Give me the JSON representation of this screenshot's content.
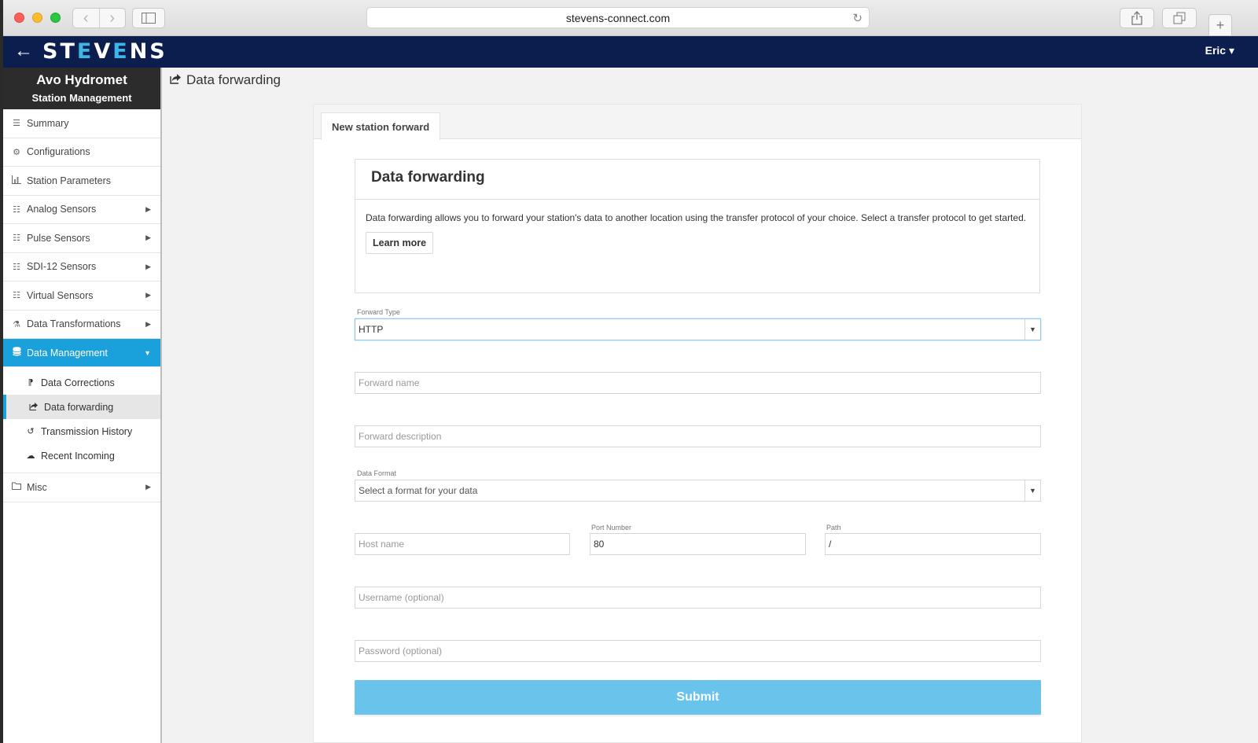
{
  "browser": {
    "url": "stevens-connect.com"
  },
  "topbar": {
    "logo": "STEVENS",
    "user": "Eric"
  },
  "sidebar": {
    "station_name": "Avo Hydromet",
    "station_sub": "Station Management",
    "items": [
      {
        "label": "Summary",
        "icon": "list-icon"
      },
      {
        "label": "Configurations",
        "icon": "gear-icon"
      },
      {
        "label": "Station Parameters",
        "icon": "chart-icon"
      },
      {
        "label": "Analog Sensors",
        "icon": "sliders-icon"
      },
      {
        "label": "Pulse Sensors",
        "icon": "sliders-icon"
      },
      {
        "label": "SDI-12 Sensors",
        "icon": "sliders-icon"
      },
      {
        "label": "Virtual Sensors",
        "icon": "sliders-icon"
      },
      {
        "label": "Data Transformations",
        "icon": "flask-icon"
      },
      {
        "label": "Data Management",
        "icon": "database-icon"
      }
    ],
    "sub_items": [
      {
        "label": "Data Corrections",
        "icon": "correction-icon"
      },
      {
        "label": "Data forwarding",
        "icon": "share-icon"
      },
      {
        "label": "Transmission History",
        "icon": "history-icon"
      },
      {
        "label": "Recent Incoming",
        "icon": "cloud-icon"
      }
    ],
    "misc": {
      "label": "Misc",
      "icon": "folder-icon"
    }
  },
  "page": {
    "title": "Data forwarding"
  },
  "card": {
    "tab": "New station forward",
    "info_title": "Data forwarding",
    "info_text": "Data forwarding allows you to forward your station's data to another location using the transfer protocol of your choice. Select a transfer protocol to get started.",
    "learn_more": "Learn more"
  },
  "form": {
    "forward_type_label": "Forward Type",
    "forward_type_value": "HTTP",
    "forward_name_placeholder": "Forward name",
    "forward_description_placeholder": "Forward description",
    "data_format_label": "Data Format",
    "data_format_placeholder": "Select a format for your data",
    "host_name_placeholder": "Host name",
    "port_label": "Port Number",
    "port_value": "80",
    "path_label": "Path",
    "path_value": "/",
    "username_placeholder": "Username (optional)",
    "password_placeholder": "Password (optional)",
    "submit": "Submit"
  },
  "colors": {
    "topbar": "#0c1e4e",
    "accent": "#1aa0da",
    "submit": "#69c3ea"
  }
}
